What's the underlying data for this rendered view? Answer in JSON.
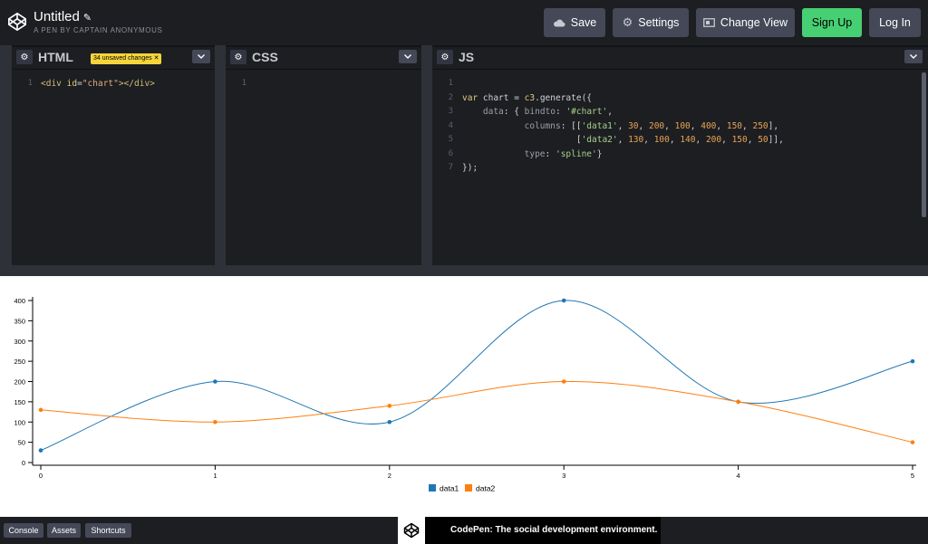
{
  "header": {
    "title": "Untitled",
    "subtitle": "A PEN BY CAPTAIN ANONYMOUS",
    "buttons": {
      "save": "Save",
      "settings": "Settings",
      "change_view": "Change View",
      "sign_up": "Sign Up",
      "log_in": "Log In"
    }
  },
  "editors": {
    "html": {
      "name": "HTML",
      "badge": "34 unsaved changes",
      "line_numbers": "1"
    },
    "css": {
      "name": "CSS",
      "line_numbers": "1"
    },
    "js": {
      "name": "JS",
      "line_numbers": "1\n2\n3\n4\n5\n6\n7"
    }
  },
  "footer": {
    "console": "Console",
    "assets": "Assets",
    "shortcuts": "Shortcuts",
    "promo": "CodePen: The social development environment."
  },
  "colors": {
    "accent_green": "#47cf73",
    "data1": "#1f77b4",
    "data2": "#ff7f0e"
  },
  "chart_data": {
    "type": "line",
    "x": [
      0,
      1,
      2,
      3,
      4,
      5
    ],
    "xticks": [
      "0",
      "1",
      "2",
      "3",
      "4",
      "5"
    ],
    "yticks": [
      "0",
      "50",
      "100",
      "150",
      "200",
      "250",
      "300",
      "350",
      "400"
    ],
    "ylim": [
      0,
      400
    ],
    "series": [
      {
        "name": "data1",
        "values": [
          30,
          200,
          100,
          400,
          150,
          250
        ],
        "color": "#1f77b4"
      },
      {
        "name": "data2",
        "values": [
          130,
          100,
          140,
          200,
          150,
          50
        ],
        "color": "#ff7f0e"
      }
    ],
    "legend": "bottom-center",
    "grid": false
  }
}
